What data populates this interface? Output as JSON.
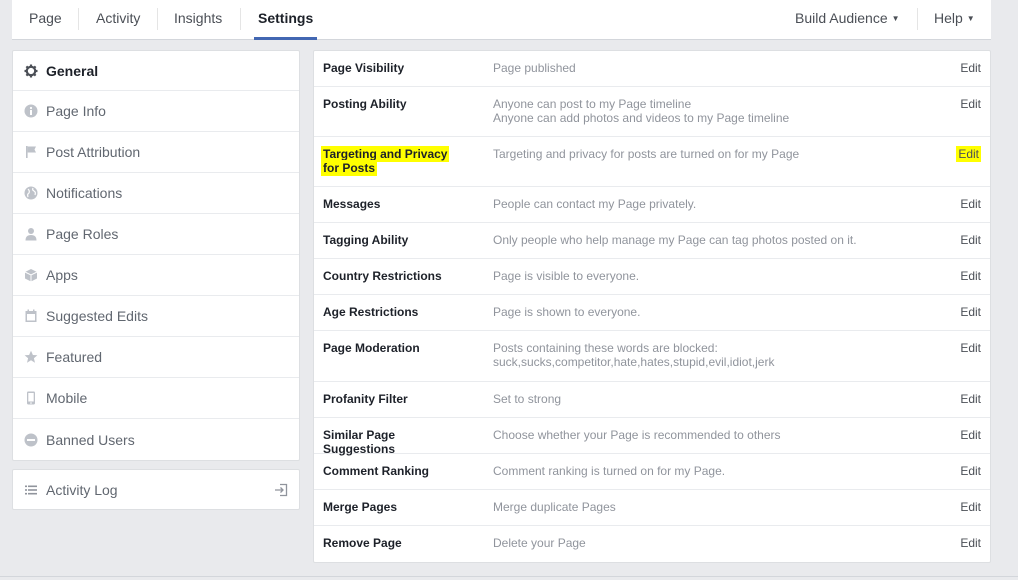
{
  "topbar": {
    "tabs": [
      "Page",
      "Activity",
      "Insights",
      "Settings"
    ],
    "active_tab": "Settings",
    "build_audience": "Build Audience",
    "help": "Help"
  },
  "sidebar": {
    "items": [
      {
        "label": "General",
        "icon": "gear-icon"
      },
      {
        "label": "Page Info",
        "icon": "info-icon"
      },
      {
        "label": "Post Attribution",
        "icon": "flag-icon"
      },
      {
        "label": "Notifications",
        "icon": "globe-icon"
      },
      {
        "label": "Page Roles",
        "icon": "person-icon"
      },
      {
        "label": "Apps",
        "icon": "cube-icon"
      },
      {
        "label": "Suggested Edits",
        "icon": "calendar-icon"
      },
      {
        "label": "Featured",
        "icon": "star-icon"
      },
      {
        "label": "Mobile",
        "icon": "phone-icon"
      },
      {
        "label": "Banned Users",
        "icon": "ban-icon"
      }
    ],
    "activity_log": "Activity Log"
  },
  "settings": [
    {
      "label": "Page Visibility",
      "value": [
        "Page published"
      ],
      "edit": "Edit"
    },
    {
      "label": "Posting Ability",
      "value": [
        "Anyone can post to my Page timeline",
        "Anyone can add photos and videos to my Page timeline"
      ],
      "edit": "Edit"
    },
    {
      "label": "Targeting and Privacy for Posts",
      "value": [
        "Targeting and privacy for posts are turned on for my Page"
      ],
      "edit": "Edit",
      "highlighted": true
    },
    {
      "label": "Messages",
      "value": [
        "People can contact my Page privately."
      ],
      "edit": "Edit"
    },
    {
      "label": "Tagging Ability",
      "value": [
        "Only people who help manage my Page can tag photos posted on it."
      ],
      "edit": "Edit"
    },
    {
      "label": "Country Restrictions",
      "value": [
        "Page is visible to everyone."
      ],
      "edit": "Edit"
    },
    {
      "label": "Age Restrictions",
      "value": [
        "Page is shown to everyone."
      ],
      "edit": "Edit"
    },
    {
      "label": "Page Moderation",
      "value": [
        "Posts containing these words are blocked:",
        "suck,sucks,competitor,hate,hates,stupid,evil,idiot,jerk"
      ],
      "edit": "Edit"
    },
    {
      "label": "Profanity Filter",
      "value": [
        "Set to strong"
      ],
      "edit": "Edit"
    },
    {
      "label": "Similar Page Suggestions",
      "value": [
        "Choose whether your Page is recommended to others"
      ],
      "edit": "Edit"
    },
    {
      "label": "Comment Ranking",
      "value": [
        "Comment ranking is turned on for my Page."
      ],
      "edit": "Edit"
    },
    {
      "label": "Merge Pages",
      "value": [
        "Merge duplicate Pages"
      ],
      "edit": "Edit"
    },
    {
      "label": "Remove Page",
      "value": [
        "Delete your Page"
      ],
      "edit": "Edit"
    }
  ],
  "colors": {
    "highlight": "#ffff00",
    "accent": "#4267b2",
    "background": "#e9eaed"
  }
}
